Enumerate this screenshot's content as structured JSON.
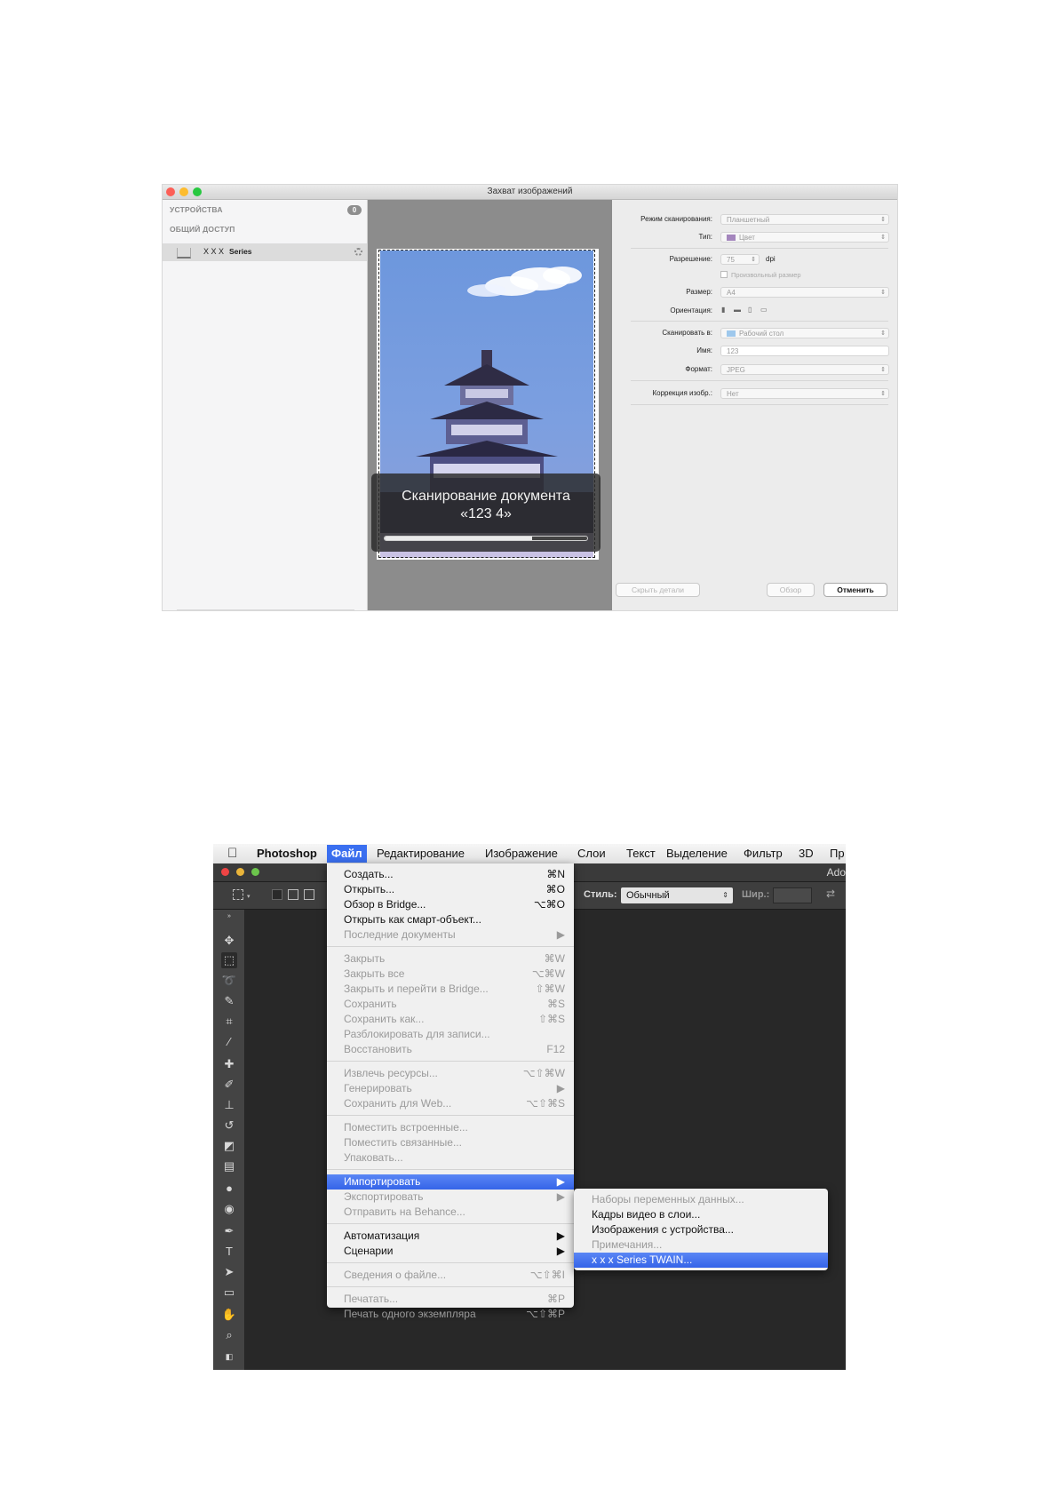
{
  "image_capture": {
    "title": "Захват изображений",
    "sidebar": {
      "devices_header": "УСТРОЙСТВА",
      "devices_badge": "0",
      "shared_header": "ОБЩИЙ ДОСТУП",
      "device_name": "X X X",
      "device_suffix": "Series"
    },
    "overlay": {
      "line1": "Сканирование документа",
      "line2": "«123 4»",
      "progress": 0.73
    },
    "settings": {
      "mode_label": "Режим сканирования:",
      "mode_value": "Планшетный",
      "type_label": "Тип:",
      "type_value": "Цвет",
      "resolution_label": "Разрешение:",
      "resolution_value": "75",
      "resolution_unit": "dpi",
      "custom_size_label": "Произвольный размер",
      "size_label": "Размер:",
      "size_value": "A4",
      "orientation_label": "Ориентация:",
      "scan_to_label": "Сканировать в:",
      "scan_to_value": "Рабочий стол",
      "name_label": "Имя:",
      "name_value": "123",
      "format_label": "Формат:",
      "format_value": "JPEG",
      "correction_label": "Коррекция изобр.:",
      "correction_value": "Нет"
    },
    "buttons": {
      "hide_details": "Скрыть детали",
      "overview": "Обзор",
      "cancel": "Отменить"
    }
  },
  "photoshop": {
    "menubar": [
      "Photoshop",
      "Файл",
      "Редактирование",
      "Изображение",
      "Слои",
      "Текст",
      "Выделение",
      "Фильтр",
      "3D",
      "Пр"
    ],
    "window_title_partial": "Ado",
    "options_bar": {
      "style_label": "Стиль:",
      "style_value": "Обычный",
      "width_label": "Шир.:"
    },
    "file_menu": [
      {
        "label": "Создать...",
        "shortcut": "⌘N",
        "enabled": true
      },
      {
        "label": "Открыть...",
        "shortcut": "⌘O",
        "enabled": true
      },
      {
        "label": "Обзор в Bridge...",
        "shortcut": "⌥⌘O",
        "enabled": true
      },
      {
        "label": "Открыть как смарт-объект...",
        "shortcut": "",
        "enabled": true
      },
      {
        "label": "Последние документы",
        "shortcut": "▶",
        "enabled": false
      },
      {
        "label": "Закрыть",
        "shortcut": "⌘W",
        "enabled": false
      },
      {
        "label": "Закрыть все",
        "shortcut": "⌥⌘W",
        "enabled": false
      },
      {
        "label": "Закрыть и перейти в Bridge...",
        "shortcut": "⇧⌘W",
        "enabled": false
      },
      {
        "label": "Сохранить",
        "shortcut": "⌘S",
        "enabled": false
      },
      {
        "label": "Сохранить как...",
        "shortcut": "⇧⌘S",
        "enabled": false
      },
      {
        "label": "Разблокировать для записи...",
        "shortcut": "",
        "enabled": false
      },
      {
        "label": "Восстановить",
        "shortcut": "F12",
        "enabled": false
      },
      {
        "label": "Извлечь ресурсы...",
        "shortcut": "⌥⇧⌘W",
        "enabled": false
      },
      {
        "label": "Генерировать",
        "shortcut": "▶",
        "enabled": false
      },
      {
        "label": "Сохранить для Web...",
        "shortcut": "⌥⇧⌘S",
        "enabled": false
      },
      {
        "label": "Поместить встроенные...",
        "shortcut": "",
        "enabled": false
      },
      {
        "label": "Поместить связанные...",
        "shortcut": "",
        "enabled": false
      },
      {
        "label": "Упаковать...",
        "shortcut": "",
        "enabled": false
      },
      {
        "label": "Импортировать",
        "shortcut": "▶",
        "enabled": true,
        "highlighted": true
      },
      {
        "label": "Экспортировать",
        "shortcut": "▶",
        "enabled": false
      },
      {
        "label": "Отправить на Behance...",
        "shortcut": "",
        "enabled": false
      },
      {
        "label": "Автоматизация",
        "shortcut": "▶",
        "enabled": true
      },
      {
        "label": "Сценарии",
        "shortcut": "▶",
        "enabled": true
      },
      {
        "label": "Сведения о файле...",
        "shortcut": "⌥⇧⌘I",
        "enabled": false
      },
      {
        "label": "Печатать...",
        "shortcut": "⌘P",
        "enabled": false
      },
      {
        "label": "Печать одного экземпляра",
        "shortcut": "⌥⇧⌘P",
        "enabled": false
      }
    ],
    "import_submenu": [
      {
        "label": "Наборы переменных данных...",
        "enabled": false
      },
      {
        "label": "Кадры видео в слои...",
        "enabled": true
      },
      {
        "label": "Изображения с устройства...",
        "enabled": true
      },
      {
        "label": "Примечания...",
        "enabled": false
      },
      {
        "label": "x x x   Series TWAIN...",
        "enabled": true,
        "highlighted": true
      }
    ],
    "colors": {
      "menu_highlight": "#3a6ff0",
      "canvas_bg": "#282828"
    }
  }
}
